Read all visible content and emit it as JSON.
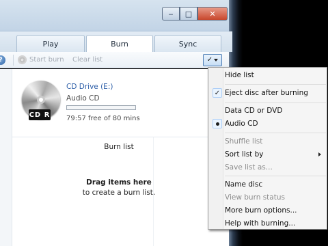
{
  "window": {
    "controls": {
      "minimize": "‒",
      "maximize": "□",
      "close": "✕"
    }
  },
  "tabs": [
    {
      "label": "Play"
    },
    {
      "label": "Burn"
    },
    {
      "label": "Sync"
    }
  ],
  "toolbar": {
    "help": "?",
    "start_burn": "Start burn",
    "clear_list": "Clear list",
    "options_glyph": "✓"
  },
  "drive": {
    "disc_label": "CD R",
    "name": "CD Drive (E:)",
    "type": "Audio CD",
    "free_text": "79:57 free of 80 mins",
    "used_fraction": 0.0
  },
  "burn_list": {
    "title": "Burn list",
    "drag_title": "Drag items here",
    "drag_sub": "to create a burn list."
  },
  "menu": {
    "items": [
      {
        "label": "Hide list",
        "enabled": true,
        "mark": ""
      },
      {
        "label": "Eject disc after burning",
        "enabled": true,
        "mark": "check"
      },
      {
        "label": "Data CD or DVD",
        "enabled": true,
        "mark": ""
      },
      {
        "label": "Audio CD",
        "enabled": true,
        "mark": "radio"
      },
      {
        "label": "Shuffle list",
        "enabled": false,
        "mark": ""
      },
      {
        "label": "Sort list by",
        "enabled": true,
        "mark": "",
        "submenu": true
      },
      {
        "label": "Save list as...",
        "enabled": false,
        "mark": ""
      },
      {
        "label": "Name disc",
        "enabled": true,
        "mark": ""
      },
      {
        "label": "View burn status",
        "enabled": false,
        "mark": ""
      },
      {
        "label": "More burn options...",
        "enabled": true,
        "mark": ""
      },
      {
        "label": "Help with burning...",
        "enabled": true,
        "mark": ""
      }
    ],
    "check_glyph": "✓"
  },
  "colors": {
    "accent": "#2e5fa8",
    "close_button": "#c8472c",
    "disabled_text": "#8d8d8d"
  }
}
